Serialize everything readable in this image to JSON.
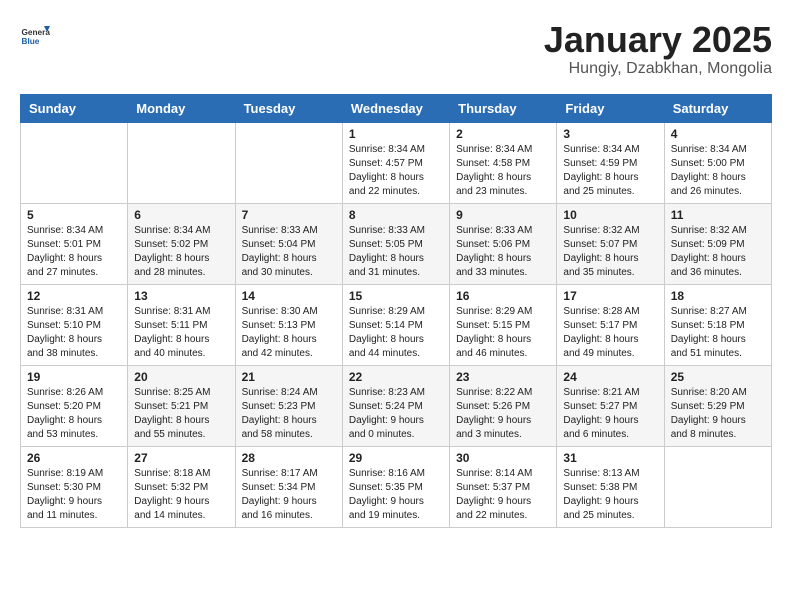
{
  "header": {
    "logo_general": "General",
    "logo_blue": "Blue",
    "month_title": "January 2025",
    "location": "Hungiy, Dzabkhan, Mongolia"
  },
  "weekdays": [
    "Sunday",
    "Monday",
    "Tuesday",
    "Wednesday",
    "Thursday",
    "Friday",
    "Saturday"
  ],
  "weeks": [
    [
      {
        "day": "",
        "info": ""
      },
      {
        "day": "",
        "info": ""
      },
      {
        "day": "",
        "info": ""
      },
      {
        "day": "1",
        "info": "Sunrise: 8:34 AM\nSunset: 4:57 PM\nDaylight: 8 hours\nand 22 minutes."
      },
      {
        "day": "2",
        "info": "Sunrise: 8:34 AM\nSunset: 4:58 PM\nDaylight: 8 hours\nand 23 minutes."
      },
      {
        "day": "3",
        "info": "Sunrise: 8:34 AM\nSunset: 4:59 PM\nDaylight: 8 hours\nand 25 minutes."
      },
      {
        "day": "4",
        "info": "Sunrise: 8:34 AM\nSunset: 5:00 PM\nDaylight: 8 hours\nand 26 minutes."
      }
    ],
    [
      {
        "day": "5",
        "info": "Sunrise: 8:34 AM\nSunset: 5:01 PM\nDaylight: 8 hours\nand 27 minutes."
      },
      {
        "day": "6",
        "info": "Sunrise: 8:34 AM\nSunset: 5:02 PM\nDaylight: 8 hours\nand 28 minutes."
      },
      {
        "day": "7",
        "info": "Sunrise: 8:33 AM\nSunset: 5:04 PM\nDaylight: 8 hours\nand 30 minutes."
      },
      {
        "day": "8",
        "info": "Sunrise: 8:33 AM\nSunset: 5:05 PM\nDaylight: 8 hours\nand 31 minutes."
      },
      {
        "day": "9",
        "info": "Sunrise: 8:33 AM\nSunset: 5:06 PM\nDaylight: 8 hours\nand 33 minutes."
      },
      {
        "day": "10",
        "info": "Sunrise: 8:32 AM\nSunset: 5:07 PM\nDaylight: 8 hours\nand 35 minutes."
      },
      {
        "day": "11",
        "info": "Sunrise: 8:32 AM\nSunset: 5:09 PM\nDaylight: 8 hours\nand 36 minutes."
      }
    ],
    [
      {
        "day": "12",
        "info": "Sunrise: 8:31 AM\nSunset: 5:10 PM\nDaylight: 8 hours\nand 38 minutes."
      },
      {
        "day": "13",
        "info": "Sunrise: 8:31 AM\nSunset: 5:11 PM\nDaylight: 8 hours\nand 40 minutes."
      },
      {
        "day": "14",
        "info": "Sunrise: 8:30 AM\nSunset: 5:13 PM\nDaylight: 8 hours\nand 42 minutes."
      },
      {
        "day": "15",
        "info": "Sunrise: 8:29 AM\nSunset: 5:14 PM\nDaylight: 8 hours\nand 44 minutes."
      },
      {
        "day": "16",
        "info": "Sunrise: 8:29 AM\nSunset: 5:15 PM\nDaylight: 8 hours\nand 46 minutes."
      },
      {
        "day": "17",
        "info": "Sunrise: 8:28 AM\nSunset: 5:17 PM\nDaylight: 8 hours\nand 49 minutes."
      },
      {
        "day": "18",
        "info": "Sunrise: 8:27 AM\nSunset: 5:18 PM\nDaylight: 8 hours\nand 51 minutes."
      }
    ],
    [
      {
        "day": "19",
        "info": "Sunrise: 8:26 AM\nSunset: 5:20 PM\nDaylight: 8 hours\nand 53 minutes."
      },
      {
        "day": "20",
        "info": "Sunrise: 8:25 AM\nSunset: 5:21 PM\nDaylight: 8 hours\nand 55 minutes."
      },
      {
        "day": "21",
        "info": "Sunrise: 8:24 AM\nSunset: 5:23 PM\nDaylight: 8 hours\nand 58 minutes."
      },
      {
        "day": "22",
        "info": "Sunrise: 8:23 AM\nSunset: 5:24 PM\nDaylight: 9 hours\nand 0 minutes."
      },
      {
        "day": "23",
        "info": "Sunrise: 8:22 AM\nSunset: 5:26 PM\nDaylight: 9 hours\nand 3 minutes."
      },
      {
        "day": "24",
        "info": "Sunrise: 8:21 AM\nSunset: 5:27 PM\nDaylight: 9 hours\nand 6 minutes."
      },
      {
        "day": "25",
        "info": "Sunrise: 8:20 AM\nSunset: 5:29 PM\nDaylight: 9 hours\nand 8 minutes."
      }
    ],
    [
      {
        "day": "26",
        "info": "Sunrise: 8:19 AM\nSunset: 5:30 PM\nDaylight: 9 hours\nand 11 minutes."
      },
      {
        "day": "27",
        "info": "Sunrise: 8:18 AM\nSunset: 5:32 PM\nDaylight: 9 hours\nand 14 minutes."
      },
      {
        "day": "28",
        "info": "Sunrise: 8:17 AM\nSunset: 5:34 PM\nDaylight: 9 hours\nand 16 minutes."
      },
      {
        "day": "29",
        "info": "Sunrise: 8:16 AM\nSunset: 5:35 PM\nDaylight: 9 hours\nand 19 minutes."
      },
      {
        "day": "30",
        "info": "Sunrise: 8:14 AM\nSunset: 5:37 PM\nDaylight: 9 hours\nand 22 minutes."
      },
      {
        "day": "31",
        "info": "Sunrise: 8:13 AM\nSunset: 5:38 PM\nDaylight: 9 hours\nand 25 minutes."
      },
      {
        "day": "",
        "info": ""
      }
    ]
  ]
}
